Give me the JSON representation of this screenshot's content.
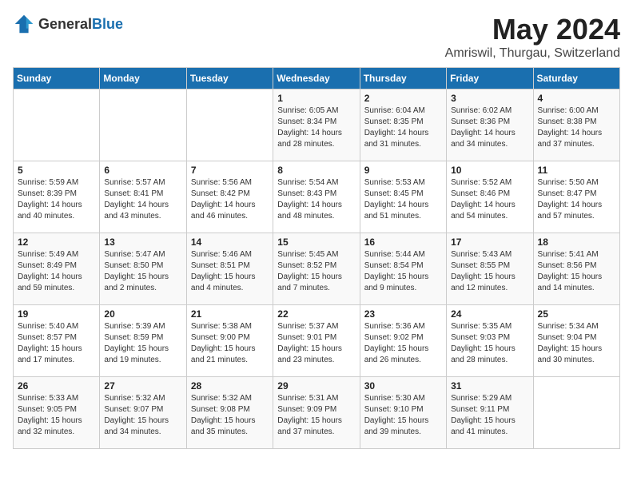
{
  "header": {
    "logo_general": "General",
    "logo_blue": "Blue",
    "month_year": "May 2024",
    "location": "Amriswil, Thurgau, Switzerland"
  },
  "weekdays": [
    "Sunday",
    "Monday",
    "Tuesday",
    "Wednesday",
    "Thursday",
    "Friday",
    "Saturday"
  ],
  "weeks": [
    [
      {
        "day": "",
        "info": ""
      },
      {
        "day": "",
        "info": ""
      },
      {
        "day": "",
        "info": ""
      },
      {
        "day": "1",
        "info": "Sunrise: 6:05 AM\nSunset: 8:34 PM\nDaylight: 14 hours\nand 28 minutes."
      },
      {
        "day": "2",
        "info": "Sunrise: 6:04 AM\nSunset: 8:35 PM\nDaylight: 14 hours\nand 31 minutes."
      },
      {
        "day": "3",
        "info": "Sunrise: 6:02 AM\nSunset: 8:36 PM\nDaylight: 14 hours\nand 34 minutes."
      },
      {
        "day": "4",
        "info": "Sunrise: 6:00 AM\nSunset: 8:38 PM\nDaylight: 14 hours\nand 37 minutes."
      }
    ],
    [
      {
        "day": "5",
        "info": "Sunrise: 5:59 AM\nSunset: 8:39 PM\nDaylight: 14 hours\nand 40 minutes."
      },
      {
        "day": "6",
        "info": "Sunrise: 5:57 AM\nSunset: 8:41 PM\nDaylight: 14 hours\nand 43 minutes."
      },
      {
        "day": "7",
        "info": "Sunrise: 5:56 AM\nSunset: 8:42 PM\nDaylight: 14 hours\nand 46 minutes."
      },
      {
        "day": "8",
        "info": "Sunrise: 5:54 AM\nSunset: 8:43 PM\nDaylight: 14 hours\nand 48 minutes."
      },
      {
        "day": "9",
        "info": "Sunrise: 5:53 AM\nSunset: 8:45 PM\nDaylight: 14 hours\nand 51 minutes."
      },
      {
        "day": "10",
        "info": "Sunrise: 5:52 AM\nSunset: 8:46 PM\nDaylight: 14 hours\nand 54 minutes."
      },
      {
        "day": "11",
        "info": "Sunrise: 5:50 AM\nSunset: 8:47 PM\nDaylight: 14 hours\nand 57 minutes."
      }
    ],
    [
      {
        "day": "12",
        "info": "Sunrise: 5:49 AM\nSunset: 8:49 PM\nDaylight: 14 hours\nand 59 minutes."
      },
      {
        "day": "13",
        "info": "Sunrise: 5:47 AM\nSunset: 8:50 PM\nDaylight: 15 hours\nand 2 minutes."
      },
      {
        "day": "14",
        "info": "Sunrise: 5:46 AM\nSunset: 8:51 PM\nDaylight: 15 hours\nand 4 minutes."
      },
      {
        "day": "15",
        "info": "Sunrise: 5:45 AM\nSunset: 8:52 PM\nDaylight: 15 hours\nand 7 minutes."
      },
      {
        "day": "16",
        "info": "Sunrise: 5:44 AM\nSunset: 8:54 PM\nDaylight: 15 hours\nand 9 minutes."
      },
      {
        "day": "17",
        "info": "Sunrise: 5:43 AM\nSunset: 8:55 PM\nDaylight: 15 hours\nand 12 minutes."
      },
      {
        "day": "18",
        "info": "Sunrise: 5:41 AM\nSunset: 8:56 PM\nDaylight: 15 hours\nand 14 minutes."
      }
    ],
    [
      {
        "day": "19",
        "info": "Sunrise: 5:40 AM\nSunset: 8:57 PM\nDaylight: 15 hours\nand 17 minutes."
      },
      {
        "day": "20",
        "info": "Sunrise: 5:39 AM\nSunset: 8:59 PM\nDaylight: 15 hours\nand 19 minutes."
      },
      {
        "day": "21",
        "info": "Sunrise: 5:38 AM\nSunset: 9:00 PM\nDaylight: 15 hours\nand 21 minutes."
      },
      {
        "day": "22",
        "info": "Sunrise: 5:37 AM\nSunset: 9:01 PM\nDaylight: 15 hours\nand 23 minutes."
      },
      {
        "day": "23",
        "info": "Sunrise: 5:36 AM\nSunset: 9:02 PM\nDaylight: 15 hours\nand 26 minutes."
      },
      {
        "day": "24",
        "info": "Sunrise: 5:35 AM\nSunset: 9:03 PM\nDaylight: 15 hours\nand 28 minutes."
      },
      {
        "day": "25",
        "info": "Sunrise: 5:34 AM\nSunset: 9:04 PM\nDaylight: 15 hours\nand 30 minutes."
      }
    ],
    [
      {
        "day": "26",
        "info": "Sunrise: 5:33 AM\nSunset: 9:05 PM\nDaylight: 15 hours\nand 32 minutes."
      },
      {
        "day": "27",
        "info": "Sunrise: 5:32 AM\nSunset: 9:07 PM\nDaylight: 15 hours\nand 34 minutes."
      },
      {
        "day": "28",
        "info": "Sunrise: 5:32 AM\nSunset: 9:08 PM\nDaylight: 15 hours\nand 35 minutes."
      },
      {
        "day": "29",
        "info": "Sunrise: 5:31 AM\nSunset: 9:09 PM\nDaylight: 15 hours\nand 37 minutes."
      },
      {
        "day": "30",
        "info": "Sunrise: 5:30 AM\nSunset: 9:10 PM\nDaylight: 15 hours\nand 39 minutes."
      },
      {
        "day": "31",
        "info": "Sunrise: 5:29 AM\nSunset: 9:11 PM\nDaylight: 15 hours\nand 41 minutes."
      },
      {
        "day": "",
        "info": ""
      }
    ]
  ]
}
